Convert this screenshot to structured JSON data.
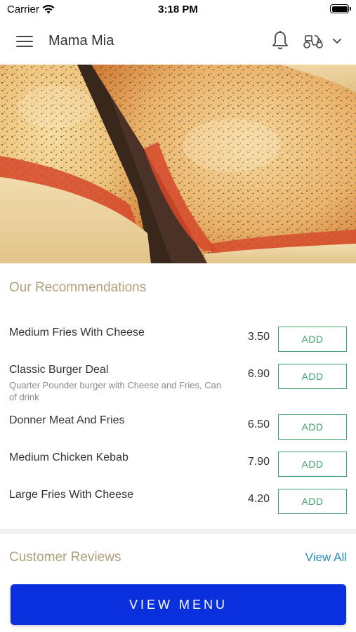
{
  "status_bar": {
    "carrier": "Carrier",
    "time": "3:18 PM"
  },
  "header": {
    "title": "Mama Mia",
    "icons": [
      "menu-icon",
      "bell-icon",
      "delivery-scooter-icon",
      "chevron-down-icon"
    ]
  },
  "hero": {
    "image": "pizza-slices-photo"
  },
  "recommendations": {
    "title": "Our Recommendations",
    "add_label": "ADD",
    "items": [
      {
        "name": "Medium Fries With Cheese",
        "description": "",
        "price": "3.50"
      },
      {
        "name": "Classic Burger Deal",
        "description": "Quarter Pounder burger with Cheese and Fries, Can of drink",
        "price": "6.90"
      },
      {
        "name": "Donner Meat And Fries",
        "description": "",
        "price": "6.50"
      },
      {
        "name": "Medium Chicken Kebab",
        "description": "",
        "price": "7.90"
      },
      {
        "name": "Large Fries With Cheese",
        "description": "",
        "price": "4.20"
      }
    ]
  },
  "reviews": {
    "title": "Customer Reviews",
    "view_all": "View All"
  },
  "footer": {
    "view_menu": "VIEW MENU"
  },
  "colors": {
    "section_title": "#b0a07a",
    "add_button": "#3fa36a",
    "link": "#2a8fbd",
    "primary_button": "#0a2fdc"
  }
}
